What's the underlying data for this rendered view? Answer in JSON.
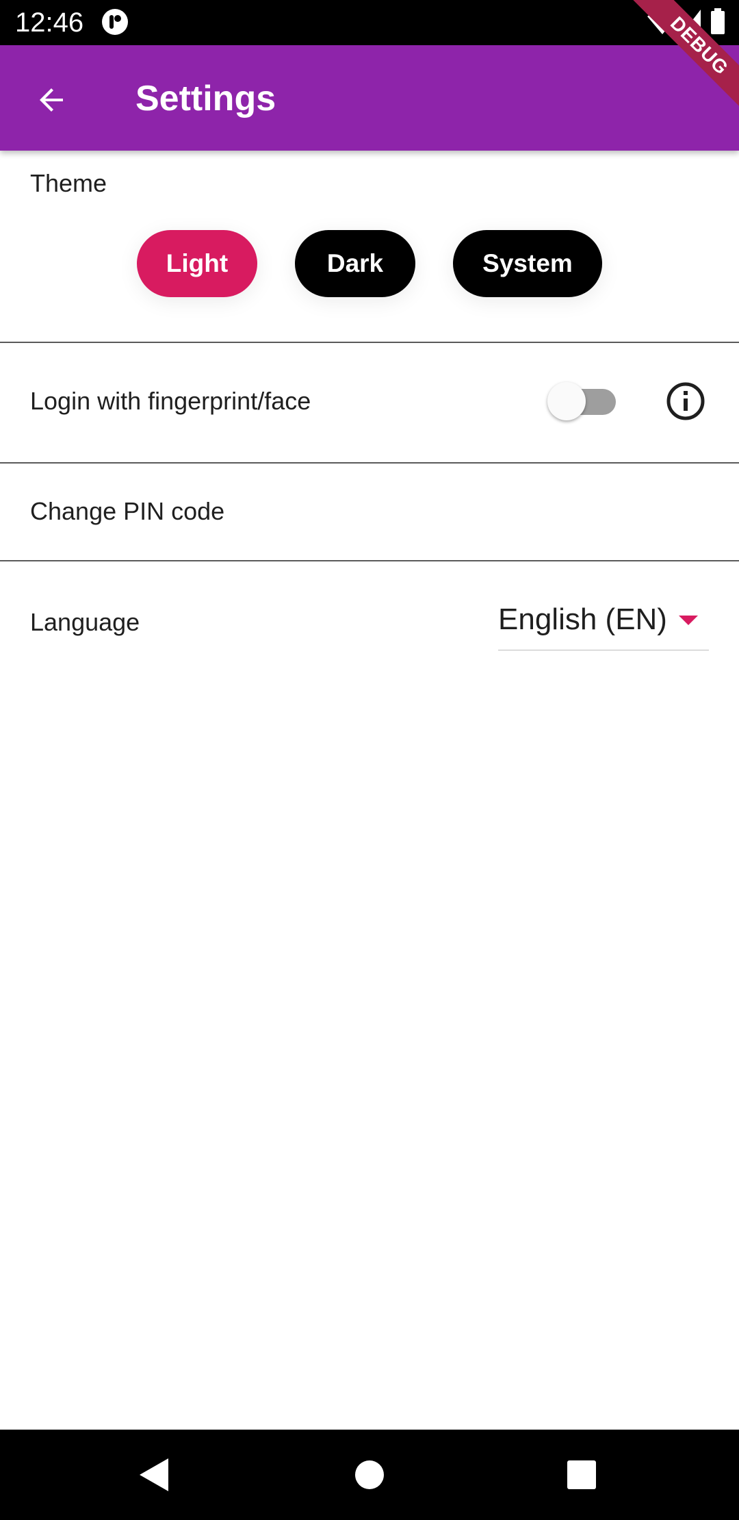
{
  "status_bar": {
    "time": "12:46"
  },
  "app_bar": {
    "title": "Settings",
    "debug_label": "DEBUG",
    "background_color": "#8e24aa"
  },
  "theme": {
    "label": "Theme",
    "options": [
      "Light",
      "Dark",
      "System"
    ],
    "selected": "Light",
    "selected_color": "#d81b60",
    "unselected_color": "#000000"
  },
  "biometric": {
    "label": "Login with fingerprint/face",
    "enabled": false,
    "info_icon": "info-icon"
  },
  "pin": {
    "label": "Change PIN code"
  },
  "language": {
    "label": "Language",
    "selected_value": "English (EN)",
    "arrow_color": "#d81b60"
  },
  "nav_bar": {
    "buttons": [
      "back-triangle-icon",
      "home-circle-icon",
      "recents-square-icon"
    ]
  }
}
